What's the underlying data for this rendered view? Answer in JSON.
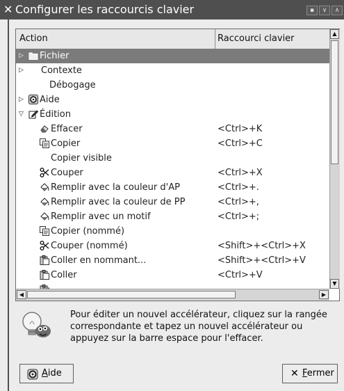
{
  "window": {
    "title": "Configurer les raccourcis clavier",
    "close_glyph": "✕"
  },
  "table": {
    "columns": [
      "Action",
      "Raccourci clavier"
    ],
    "rows": [
      {
        "label": "Fichier",
        "shortcut": "",
        "level": 0,
        "expander": "▷",
        "icon": "folder-icon",
        "selected": true
      },
      {
        "label": "Contexte",
        "shortcut": "",
        "level": 0,
        "expander": "▷",
        "icon": "",
        "selected": false
      },
      {
        "label": "Débogage",
        "shortcut": "",
        "level": 0,
        "expander": "",
        "icon": "",
        "selected": false
      },
      {
        "label": "Aide",
        "shortcut": "",
        "level": 0,
        "expander": "▷",
        "icon": "help-icon",
        "selected": false
      },
      {
        "label": "Édition",
        "shortcut": "",
        "level": 0,
        "expander": "▽",
        "icon": "edit-icon",
        "selected": false
      },
      {
        "label": "Effacer",
        "shortcut": "<Ctrl>+K",
        "level": 1,
        "expander": "",
        "icon": "eraser-icon",
        "selected": false
      },
      {
        "label": "Copier",
        "shortcut": "<Ctrl>+C",
        "level": 1,
        "expander": "",
        "icon": "copy-icon",
        "selected": false
      },
      {
        "label": "Copier visible",
        "shortcut": "",
        "level": 1,
        "expander": "",
        "icon": "",
        "selected": false
      },
      {
        "label": "Couper",
        "shortcut": "<Ctrl>+X",
        "level": 1,
        "expander": "",
        "icon": "scissors-icon",
        "selected": false
      },
      {
        "label": "Remplir avec la couleur d'AP",
        "shortcut": "<Ctrl>+.",
        "level": 1,
        "expander": "",
        "icon": "bucket-fill-icon",
        "selected": false
      },
      {
        "label": "Remplir avec la couleur de PP",
        "shortcut": "<Ctrl>+,",
        "level": 1,
        "expander": "",
        "icon": "bucket-fill-icon",
        "selected": false
      },
      {
        "label": "Remplir avec un motif",
        "shortcut": "<Ctrl>+;",
        "level": 1,
        "expander": "",
        "icon": "bucket-fill-icon",
        "selected": false
      },
      {
        "label": "Copier (nommé)",
        "shortcut": "",
        "level": 1,
        "expander": "",
        "icon": "copy-icon",
        "selected": false
      },
      {
        "label": "Couper (nommé)",
        "shortcut": "<Shift>+<Ctrl>+X",
        "level": 1,
        "expander": "",
        "icon": "scissors-icon",
        "selected": false
      },
      {
        "label": "Coller en nommant...",
        "shortcut": "<Shift>+<Ctrl>+V",
        "level": 1,
        "expander": "",
        "icon": "paste-icon",
        "selected": false
      },
      {
        "label": "Coller",
        "shortcut": "<Ctrl>+V",
        "level": 1,
        "expander": "",
        "icon": "paste-icon",
        "selected": false
      },
      {
        "label": "",
        "shortcut": "",
        "level": 1,
        "expander": "",
        "icon": "paste-icon",
        "selected": false
      }
    ]
  },
  "info": {
    "text": "Pour éditer un nouvel accélérateur, cliquez sur la rangée correspondante et tapez un nouvel accélérateur ou appuyez sur la barre espace pour l'effacer."
  },
  "buttons": {
    "help_label": "Aide",
    "help_mnemonic": "A",
    "close_label": "Fermer",
    "close_mnemonic": "F"
  }
}
